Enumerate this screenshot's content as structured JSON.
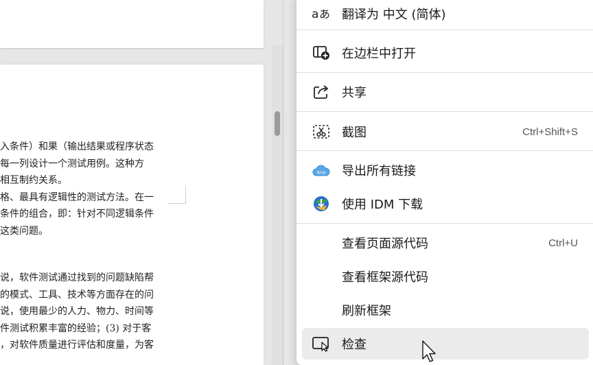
{
  "document": {
    "lines": [
      "入条件）和果（输出结果或程序状态",
      "每一列设计一个测试用例。这种方",
      "相互制约关系。",
      "格、最具有逻辑性的测试方法。在一",
      "条件的组合，即：针对不同逻辑条件",
      "这类问题。",
      "",
      "说，软件测试通过找到的问题缺陷帮",
      "的模式、工具、技术等方面存在的问",
      "说，使用最少的人力、物力、时间等",
      "件测试积累丰富的经验；(3) 对于客",
      "，对软件质量进行评估和度量，为客"
    ]
  },
  "context_menu": {
    "items": [
      {
        "label": "翻译为 中文 (简体)",
        "icon": "translate-icon",
        "shortcut": ""
      },
      {
        "label": "在边栏中打开",
        "icon": "open-in-sidebar-icon",
        "shortcut": ""
      },
      {
        "label": "共享",
        "icon": "share-icon",
        "shortcut": ""
      },
      {
        "label": "截图",
        "icon": "screenshot-icon",
        "shortcut": "Ctrl+Shift+S"
      },
      {
        "label": "导出所有链接",
        "icon": "aria-cloud-icon",
        "shortcut": ""
      },
      {
        "label": "使用 IDM 下载",
        "icon": "idm-icon",
        "shortcut": ""
      },
      {
        "label": "查看页面源代码",
        "icon": "",
        "shortcut": "Ctrl+U"
      },
      {
        "label": "查看框架源代码",
        "icon": "",
        "shortcut": ""
      },
      {
        "label": "刷新框架",
        "icon": "",
        "shortcut": ""
      },
      {
        "label": "检查",
        "icon": "inspect-icon",
        "shortcut": ""
      }
    ]
  },
  "icons": {
    "aria_badge": "Aria"
  },
  "colors": {
    "menu_bg": "#ffffff",
    "hover_bg": "#ebebeb",
    "aria_blue": "#3a8fd6",
    "idm_green": "#3aa24a",
    "idm_blue": "#2a6fc9"
  }
}
